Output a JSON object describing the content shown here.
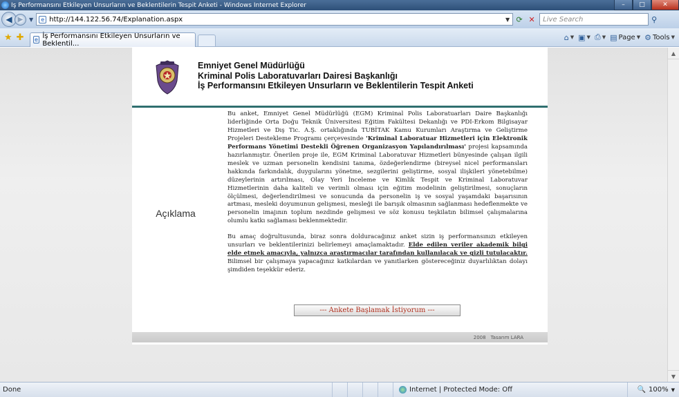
{
  "window": {
    "title": "İş Performansını Etkileyen Unsurların ve Beklentilerin Tespit Anketi - Windows Internet Explorer",
    "minimize": "–",
    "maximize": "□",
    "close": "✕"
  },
  "addressbar": {
    "url": "http://144.122.56.74/Explanation.aspx",
    "search_placeholder": "Live Search"
  },
  "tabbar": {
    "tab_title": "İş Performansını Etkileyen Unsurların ve Beklentil...",
    "page_label": "Page",
    "tools_label": "Tools"
  },
  "header": {
    "line1": "Emniyet Genel Müdürlüğü",
    "line2": "Kriminal Polis Laboratuvarları Dairesi Başkanlığı",
    "line3": "İş Performansını Etkileyen Unsurların ve Beklentilerin Tespit Anketi"
  },
  "content": {
    "section_label": "Açıklama",
    "p1_a": "Bu anket, Emniyet Genel Müdürlüğü (EGM) Kriminal Polis Laboratuarları Daire Başkanlığı liderliğinde Orta Doğu Teknik Üniversitesi Eğitim Fakültesi Dekanlığı ve PDI-Erkom Bilgisayar Hizmetleri ve Dış Tic. A.Ş. ortaklığında TUBİTAK Kamu Kurumları Araştırma ve Geliştirme Projeleri Destekleme Programı çerçevesinde ",
    "p1_bold": "'Kriminal Laboratuar Hizmetleri için Elektronik Performans Yönetimi Destekli Öğrenen Organizasyon Yapılandırılması'",
    "p1_b": " projesi kapsamında hazırlanmıştır. Önerilen proje ile, EGM Kriminal Laboratuvar Hizmetleri bünyesinde çalışan ilgili meslek ve uzman personelin kendisini tanıma, özdeğerlendirme (bireysel nicel performansları hakkında farkındalık, duygularını yönetme, sezgilerini geliştirme, sosyal ilişkileri yönetebilme) düzeylerinin artırılması, Olay Yeri İnceleme ve Kimlik Tespit ve Kriminal Laboratuvar Hizmetlerinin daha kaliteli ve verimli olması için eğitim modelinin geliştirilmesi, sonuçların ölçülmesi, değerlendirilmesi ve sonucunda da personelin iş ve sosyal yaşamdaki başarısının artması, mesleki doyumunun gelişmesi, mesleği ile barışık olmasının sağlanması hedeflenmekte ve personelin imajının toplum nezdinde gelişmesi ve söz konusu teşkilatın bilimsel çalışmalarına olumlu katkı sağlaması beklenmektedir.",
    "p2_a": "Bu amaç doğrultusunda, biraz sonra dolduracağınız anket sizin iş performansınızı etkileyen unsurları ve beklentilerinizi belirlemeyi amaçlamaktadır. ",
    "p2_underline": "Elde edilen veriler akademik bilgi elde etmek amacıyla, yalnızca araştırmacılar tarafından kullanılacak ve gizli tutulacaktır.",
    "p2_b": " Bilimsel bir çalışmaya yapacağınız katkılardan ve yanıtlarken göstereceğiniz duyarlılıktan dolayı şimdiden teşekkür ederiz.",
    "start_button": "--- Ankete Başlamak İstiyorum ---"
  },
  "footer": {
    "year": "2008",
    "credit": "Tasarım LARA"
  },
  "statusbar": {
    "status": "Done",
    "zone": "Internet | Protected Mode: Off",
    "zoom": "100%"
  }
}
